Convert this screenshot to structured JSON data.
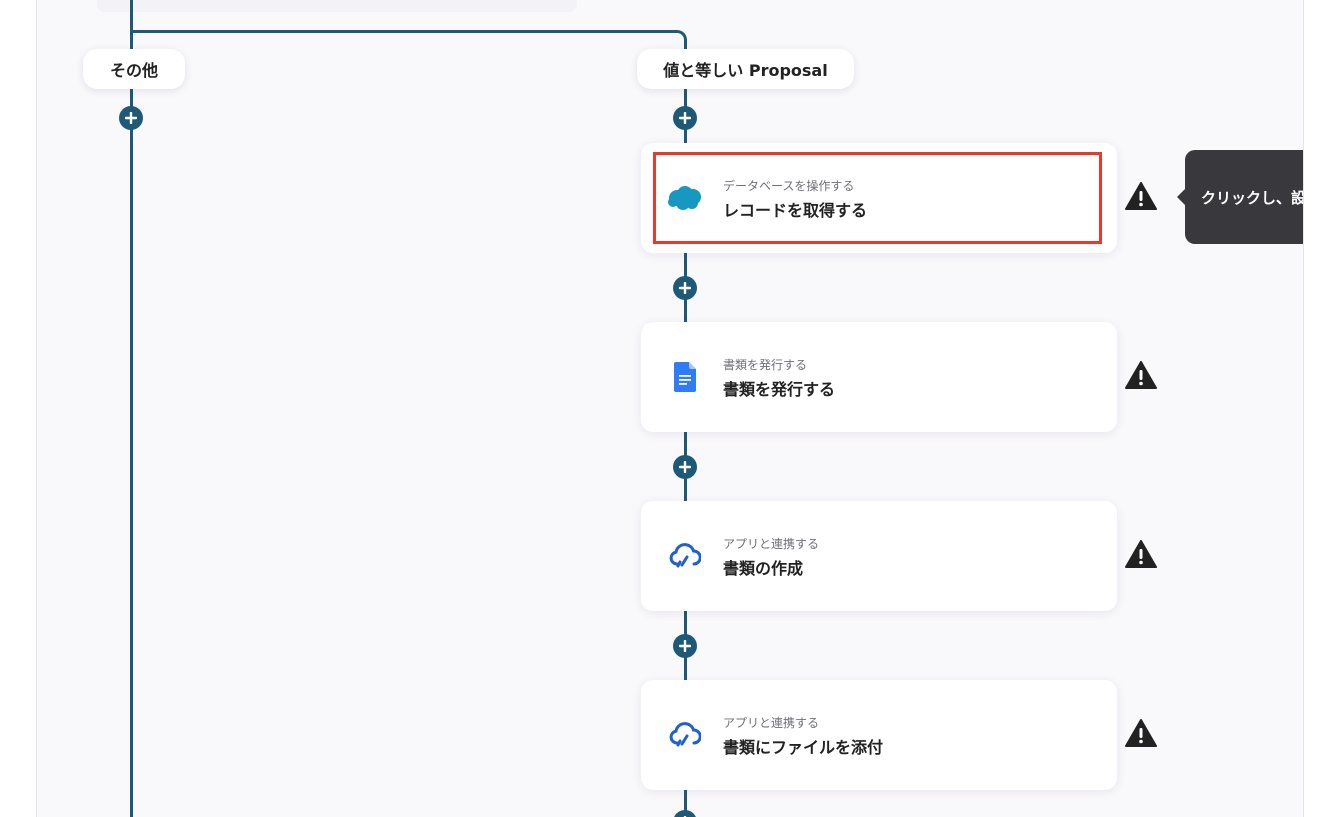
{
  "branches": {
    "left": {
      "label": "その他"
    },
    "right": {
      "label": "値と等しい Proposal"
    }
  },
  "steps": [
    {
      "subtitle": "データベースを操作する",
      "title": "レコードを取得する",
      "icon": "salesforce-cloud-icon",
      "highlighted": true
    },
    {
      "subtitle": "書類を発行する",
      "title": "書類を発行する",
      "icon": "google-docs-icon",
      "highlighted": false
    },
    {
      "subtitle": "アプリと連携する",
      "title": "書類の作成",
      "icon": "cloud-link-icon",
      "highlighted": false
    },
    {
      "subtitle": "アプリと連携する",
      "title": "書類にファイルを添付",
      "icon": "cloud-link-icon",
      "highlighted": false
    }
  ],
  "tooltip": {
    "text": "クリックし、設"
  },
  "colors": {
    "connector": "#1e5a78",
    "highlight": "#e8392d",
    "tooltip_bg": "#39393d",
    "canvas_bg": "#f9f8fb"
  }
}
